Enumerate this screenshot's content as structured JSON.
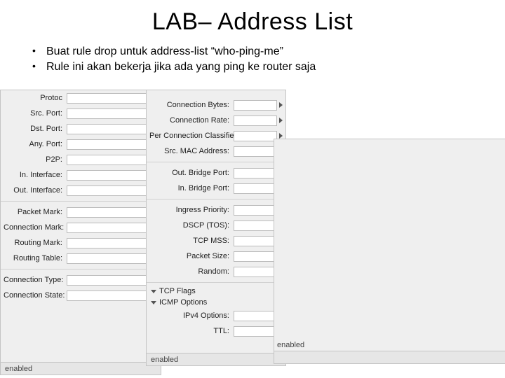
{
  "title": "LAB– Address List",
  "bullets": [
    "Buat rule drop untuk address-list “who-ping-me”",
    "Rule ini akan bekerja jika ada yang ping ke router saja"
  ],
  "panel1": {
    "rows": [
      {
        "label": "Protoc",
        "dropdown": true
      },
      {
        "label": "Src. Port:"
      },
      {
        "label": "Dst. Port:"
      },
      {
        "label": "Any. Port:"
      },
      {
        "label": "P2P:"
      },
      {
        "label": "In. Interface:"
      },
      {
        "label": "Out. Interface:"
      }
    ],
    "rows2": [
      {
        "label": "Packet Mark:"
      },
      {
        "label": "Connection Mark:"
      },
      {
        "label": "Routing Mark:"
      },
      {
        "label": "Routing Table:"
      }
    ],
    "rows3": [
      {
        "label": "Connection Type:"
      },
      {
        "label": "Connection State:"
      }
    ],
    "status": "enabled"
  },
  "panel2": {
    "rows": [
      {
        "label": "Connection Bytes:"
      },
      {
        "label": "Connection Rate:"
      },
      {
        "label": "Per Connection Classifier:"
      },
      {
        "label": "Src. MAC Address:"
      }
    ],
    "rows2": [
      {
        "label": "Out. Bridge Port:"
      },
      {
        "label": "In. Bridge Port:"
      }
    ],
    "rows3": [
      {
        "label": "Ingress Priority:"
      },
      {
        "label": "DSCP (TOS):"
      },
      {
        "label": "TCP MSS:"
      },
      {
        "label": "Packet Size:"
      },
      {
        "label": "Random:"
      }
    ],
    "sections": [
      {
        "label": "TCP Flags"
      },
      {
        "label": "ICMP Options"
      }
    ],
    "rows4": [
      {
        "label": "IPv4 Options:"
      },
      {
        "label": "TTL:"
      }
    ],
    "status": "enabled"
  },
  "panel3": {
    "status": "enabled"
  }
}
